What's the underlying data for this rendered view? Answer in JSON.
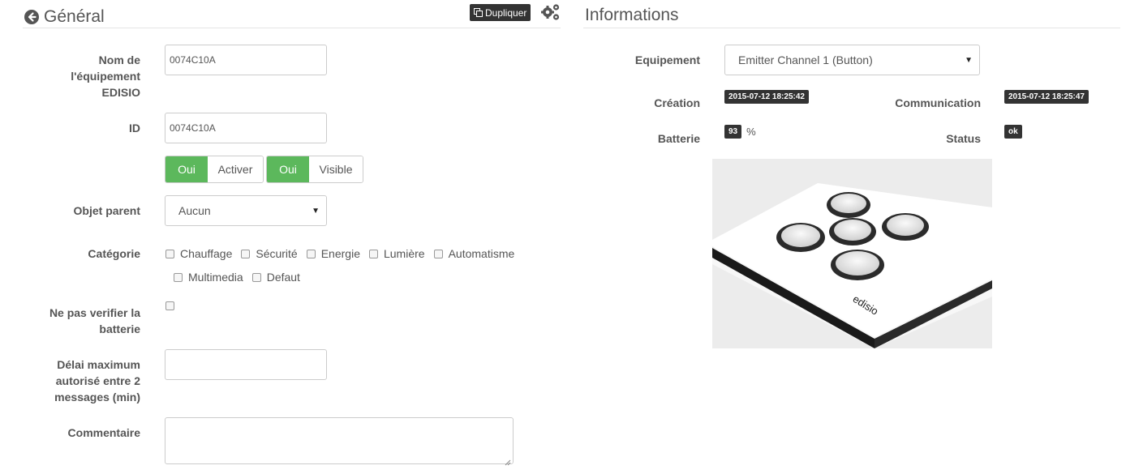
{
  "general": {
    "title": "Général",
    "duplicate_label": "Dupliquer",
    "name_label": "Nom de l'équipement EDISIO",
    "name_value": "0074C10A",
    "id_label": "ID",
    "id_value": "0074C10A",
    "toggle_enable": {
      "on": "Oui",
      "off": "Activer"
    },
    "toggle_visible": {
      "on": "Oui",
      "off": "Visible"
    },
    "parent_label": "Objet parent",
    "parent_value": "Aucun",
    "category_label": "Catégorie",
    "categories": [
      "Chauffage",
      "Sécurité",
      "Energie",
      "Lumière",
      "Automatisme",
      "Multimedia",
      "Defaut"
    ],
    "battery_check_label": "Ne pas verifier la batterie",
    "max_delay_label": "Délai maximum autorisé entre 2 messages (min)",
    "max_delay_value": "",
    "comment_label": "Commentaire",
    "comment_value": ""
  },
  "informations": {
    "title": "Informations",
    "equipment_label": "Equipement",
    "equipment_value": "Emitter Channel 1 (Button)",
    "creation_label": "Création",
    "creation_value": "2015-07-12 18:25:42",
    "communication_label": "Communication",
    "communication_value": "2015-07-12 18:25:47",
    "battery_label": "Batterie",
    "battery_value": "93",
    "battery_unit": "%",
    "status_label": "Status",
    "status_value": "ok",
    "device_brand": "edisio"
  },
  "colors": {
    "accent_green": "#5cb85c",
    "badge_dark": "#333333"
  },
  "icons": {
    "back": "arrow-circle-left-icon",
    "duplicate": "copy-icon",
    "config": "gears-icon"
  }
}
